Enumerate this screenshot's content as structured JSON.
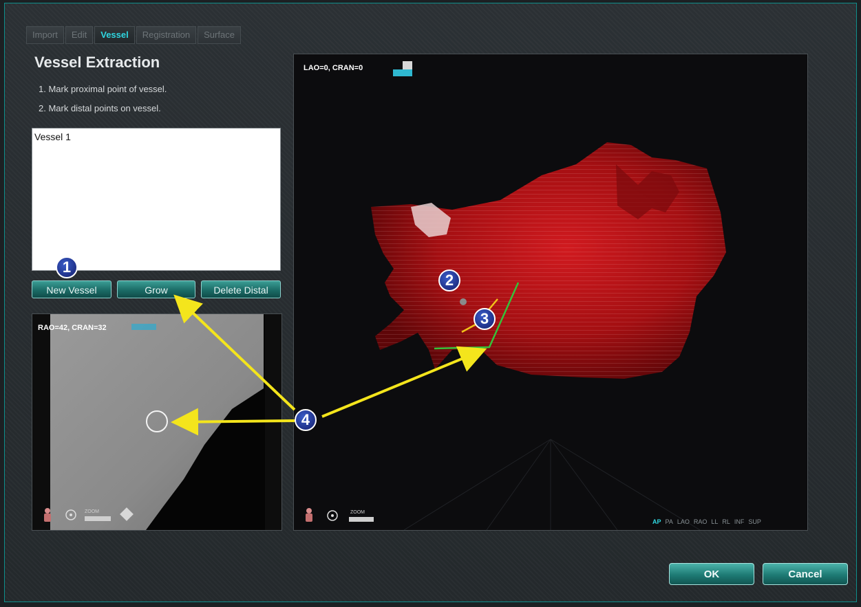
{
  "tabs": [
    {
      "label": "Import"
    },
    {
      "label": "Edit"
    },
    {
      "label": "Vessel"
    },
    {
      "label": "Registration"
    },
    {
      "label": "Surface"
    }
  ],
  "active_tab": "Vessel",
  "page_title": "Vessel Extraction",
  "steps": [
    "1.  Mark proximal point of vessel.",
    "2.  Mark distal points on vessel."
  ],
  "vessel_list": [
    "Vessel 1"
  ],
  "buttons": {
    "new_vessel": "New Vessel",
    "grow": "Grow",
    "delete_distal": "Delete Distal",
    "ok": "OK",
    "cancel": "Cancel"
  },
  "fluoro_view": {
    "orientation": "RAO=42, CRAN=32",
    "zoom_label": "ZOOM"
  },
  "main_view": {
    "orientation": "LAO=0, CRAN=0",
    "zoom_label": "ZOOM",
    "view_presets": [
      "AP",
      "PA",
      "LAO",
      "RAO",
      "LL",
      "RL",
      "INF",
      "SUP"
    ],
    "active_preset": "AP"
  },
  "callouts": [
    "1",
    "2",
    "3",
    "4"
  ],
  "colors": {
    "accent": "#2fd6e0",
    "button": "#1b6b66",
    "mesh": "#a40f12",
    "callout_arrow": "#f4e51c",
    "vessel_axis_green": "#36c23a",
    "vessel_axis_yellow": "#f2c21a"
  }
}
